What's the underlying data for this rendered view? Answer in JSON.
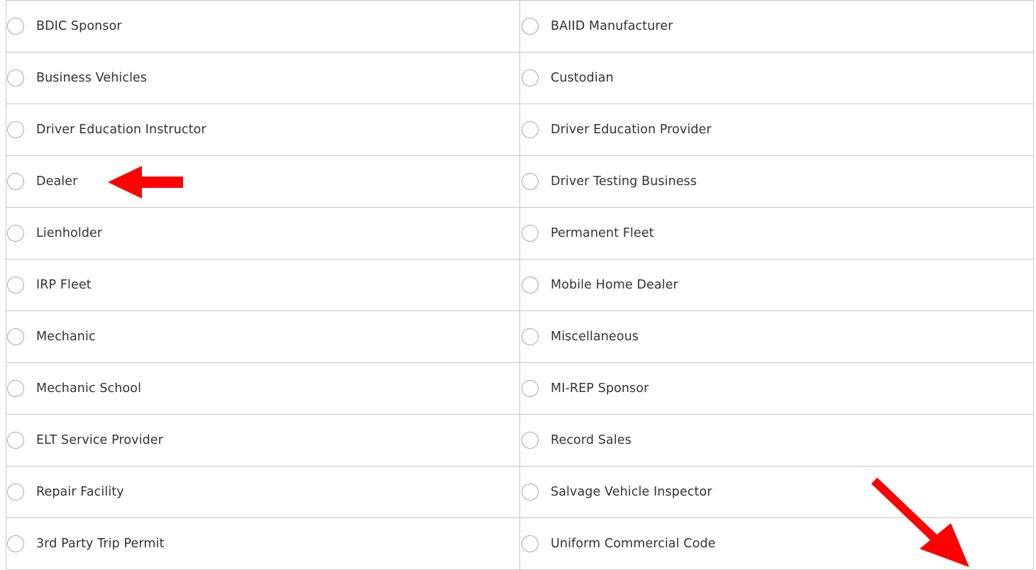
{
  "options": {
    "rows": [
      {
        "left": "BDIC Sponsor",
        "right": "BAIID Manufacturer"
      },
      {
        "left": "Business Vehicles",
        "right": "Custodian"
      },
      {
        "left": "Driver Education Instructor",
        "right": "Driver Education Provider"
      },
      {
        "left": "Dealer",
        "right": "Driver Testing Business"
      },
      {
        "left": "Lienholder",
        "right": "Permanent Fleet"
      },
      {
        "left": "IRP Fleet",
        "right": "Mobile Home Dealer"
      },
      {
        "left": "Mechanic",
        "right": "Miscellaneous"
      },
      {
        "left": "Mechanic School",
        "right": "MI-REP Sponsor"
      },
      {
        "left": "ELT Service Provider",
        "right": "Record Sales"
      },
      {
        "left": "Repair Facility",
        "right": "Salvage Vehicle Inspector"
      },
      {
        "left": "3rd Party Trip Permit",
        "right": "Uniform Commercial Code"
      }
    ]
  },
  "annotations": {
    "arrow_color": "#ff0000",
    "arrow_left_icon": "arrow-left-icon",
    "arrow_down_right_icon": "arrow-down-right-icon"
  }
}
